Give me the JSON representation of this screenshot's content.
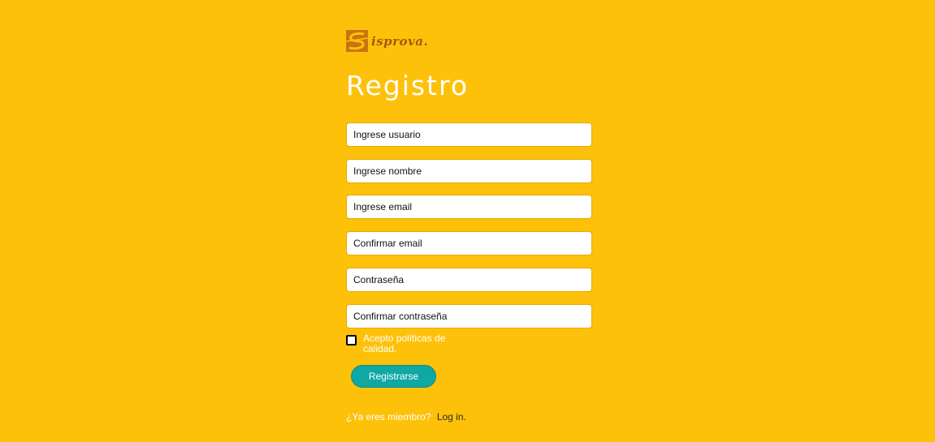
{
  "logo": {
    "text": "isprova."
  },
  "page": {
    "title": "Registro"
  },
  "form": {
    "fields": [
      {
        "placeholder": "Ingrese usuario",
        "value": ""
      },
      {
        "placeholder": "Ingrese nombre",
        "value": ""
      },
      {
        "placeholder": "Ingrese email",
        "value": ""
      },
      {
        "placeholder": "Confirmar email",
        "value": ""
      },
      {
        "placeholder": "Contraseña",
        "value": ""
      },
      {
        "placeholder": "Confirmar contraseña",
        "value": ""
      }
    ],
    "terms_label": "Acepto políticas de calidad.",
    "terms_checked": false,
    "submit_label": "Registrarse"
  },
  "footer": {
    "member_question": "¿Ya eres miembro?",
    "login_label": "Log in."
  },
  "colors": {
    "background": "#FEC109",
    "button": "#0FA8A3",
    "logo": "#A8580B"
  }
}
